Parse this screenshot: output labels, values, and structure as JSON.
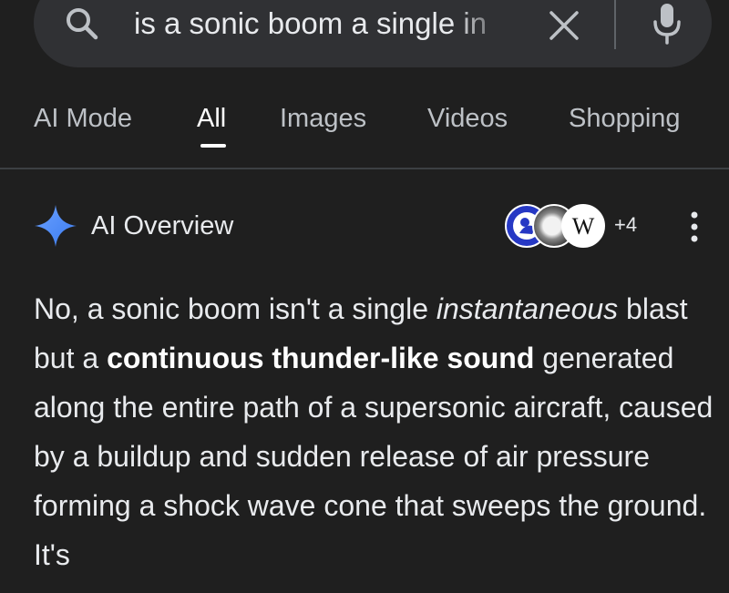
{
  "search": {
    "query": "is a sonic boom a single in",
    "icons": {
      "search": "search-icon",
      "clear": "close-icon",
      "voice": "microphone-icon"
    }
  },
  "tabs": [
    {
      "label": "AI Mode",
      "active": false
    },
    {
      "label": "All",
      "active": true
    },
    {
      "label": "Images",
      "active": false
    },
    {
      "label": "Videos",
      "active": false
    },
    {
      "label": "Shopping",
      "active": false
    }
  ],
  "ai_overview": {
    "title": "AI Overview",
    "sources": {
      "icons": [
        "pbs-icon",
        "image-source-icon",
        "wikipedia-icon"
      ],
      "wiki_letter": "W",
      "more": "+4"
    },
    "answer": {
      "part1": "No, a sonic boom isn't a single ",
      "italic": "instantaneous",
      "part2": " blast but a ",
      "bold": "continuous thunder-like sound",
      "part3": " generated along the entire path of a supersonic aircraft, caused by a buildup and sudden release of air pressure forming a shock wave cone that sweeps the ground. It's"
    }
  },
  "colors": {
    "background": "#1f1f1f",
    "search_bar": "#303134",
    "text": "#e8eaed",
    "muted_text": "#bdc1c6",
    "active_tab": "#ffffff",
    "pbs_blue": "#2638c4",
    "sparkle_blue": "#4c8df6"
  }
}
